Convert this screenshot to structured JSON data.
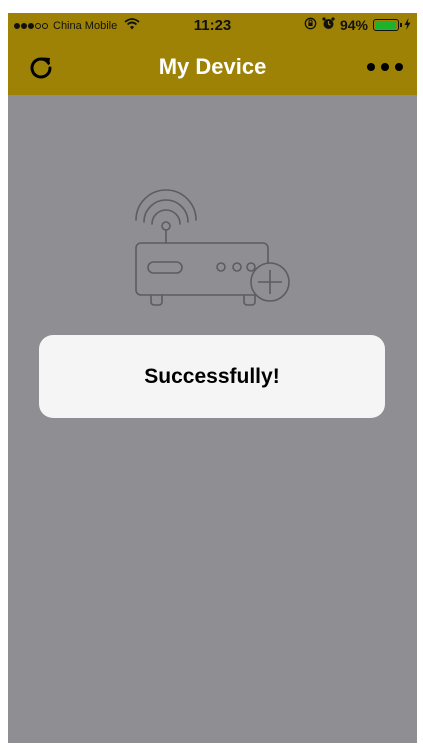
{
  "status_bar": {
    "carrier": "China Mobile",
    "time": "11:23",
    "battery_percent": "94%",
    "signal_bars_filled": 3,
    "signal_bars_total": 5,
    "battery_level": 0.94,
    "battery_color": "#1eb32f"
  },
  "navbar": {
    "title": "My Device",
    "background_color": "#9e8205",
    "left_icon": "refresh-icon",
    "right_icon": "more-icon"
  },
  "content": {
    "background_color": "#8f8e93",
    "illustration_icon": "router-add-icon"
  },
  "toast": {
    "message": "Successfully!"
  }
}
